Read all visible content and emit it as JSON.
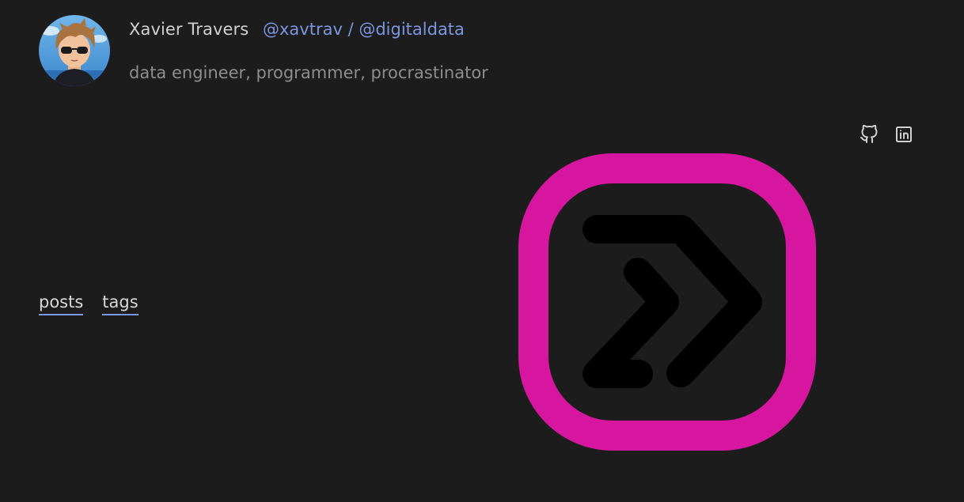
{
  "header": {
    "name": "Xavier Travers",
    "handle_primary": "@xavtrav",
    "handle_separator": "/",
    "handle_secondary": "@digitaldata",
    "tagline": "data engineer, programmer, procrastinator"
  },
  "social": {
    "github_icon": "github-icon",
    "linkedin_icon": "linkedin-icon"
  },
  "nav": {
    "items": [
      {
        "label": "posts"
      },
      {
        "label": "tags"
      }
    ]
  },
  "logo": {
    "icon": "chevron-double-right-logo",
    "frame_color": "#d6169f",
    "glyph_color": "#000000"
  },
  "theme": {
    "background": "#1c1c1c",
    "link_color": "#7b96e0"
  }
}
